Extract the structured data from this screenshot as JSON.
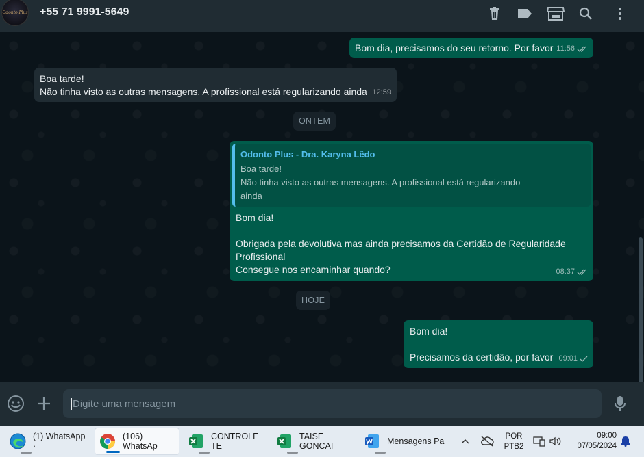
{
  "header": {
    "avatar_text": "Odonto Plus",
    "contact": "+55 71 9991-5649",
    "icons": [
      "trash-icon",
      "label-icon",
      "store-icon",
      "search-icon",
      "more-vert-icon"
    ]
  },
  "messages": [
    {
      "text": "Bom dia, precisamos do seu retorno. Por favor",
      "time": "11:56"
    },
    {
      "lines": [
        "Boa tarde!",
        "Não tinha visto as outras mensagens. A profissional está regularizando ainda"
      ],
      "time": "12:59"
    },
    {
      "quote": {
        "author": "Odonto Plus - Dra. Karyna Lêdo",
        "lines": [
          "Boa tarde!",
          "Não tinha visto as outras mensagens. A profissional está regularizando",
          "ainda"
        ]
      },
      "lines": [
        "Bom dia!",
        "",
        "Obrigada pela devolutiva mas ainda precisamos da  Certidão de Regularidade",
        "Profissional",
        "Consegue nos encaminhar quando?"
      ],
      "time": "08:37"
    },
    {
      "lines": [
        "Bom dia!",
        "",
        "Precisamos da certidão, por favor"
      ],
      "time": "09:01"
    }
  ],
  "days": {
    "yesterday": "ONTEM",
    "today": "HOJE"
  },
  "composer": {
    "placeholder": "Digite uma mensagem",
    "icons": [
      "emoji-icon",
      "plus-icon",
      "mic-icon"
    ]
  },
  "colors": {
    "outgoing": "#005c4b",
    "incoming": "#202c33",
    "accent": "#53bdeb",
    "background": "#0b141a"
  },
  "taskbar": {
    "apps": [
      {
        "label": "(1) WhatsApp ·",
        "icon": "edge-icon"
      },
      {
        "label": "(106) WhatsAp",
        "icon": "chrome-icon"
      },
      {
        "label": "CONTROLE TE",
        "icon": "excel-icon"
      },
      {
        "label": "TAISE GONCAI",
        "icon": "excel-icon"
      },
      {
        "label": "Mensagens Pa",
        "icon": "word-icon"
      }
    ],
    "lang_line1": "POR",
    "lang_line2": "PTB2",
    "time": "09:00",
    "date": "07/05/2024"
  }
}
